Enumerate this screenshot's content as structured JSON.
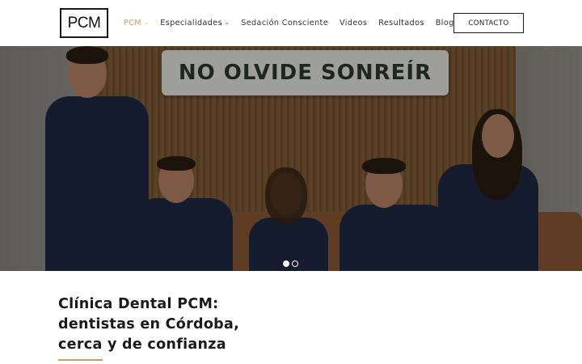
{
  "header": {
    "logo_text": "PCM",
    "nav": [
      {
        "label": "PCM",
        "has_dropdown": true,
        "active": true
      },
      {
        "label": "Especialidades",
        "has_dropdown": true,
        "active": false
      },
      {
        "label": "Sedación Consciente",
        "has_dropdown": false,
        "active": false
      },
      {
        "label": "Videos",
        "has_dropdown": false,
        "active": false
      },
      {
        "label": "Resultados",
        "has_dropdown": false,
        "active": false
      },
      {
        "label": "Blog",
        "has_dropdown": false,
        "active": false
      }
    ],
    "contact_label": "CONTACTO"
  },
  "hero": {
    "sign_text": "NO OLVIDE SONREÍR",
    "slides_total": 2,
    "active_slide": 1
  },
  "main": {
    "headline_lines": [
      "Clínica Dental PCM:",
      "dentistas en Córdoba,",
      "cerca y de confianza"
    ]
  },
  "colors": {
    "accent": "#c4a06a",
    "text": "#1a1a1a",
    "scrub": "#1f2a44"
  },
  "icons": {
    "dropdown": "chevron-down-icon"
  }
}
